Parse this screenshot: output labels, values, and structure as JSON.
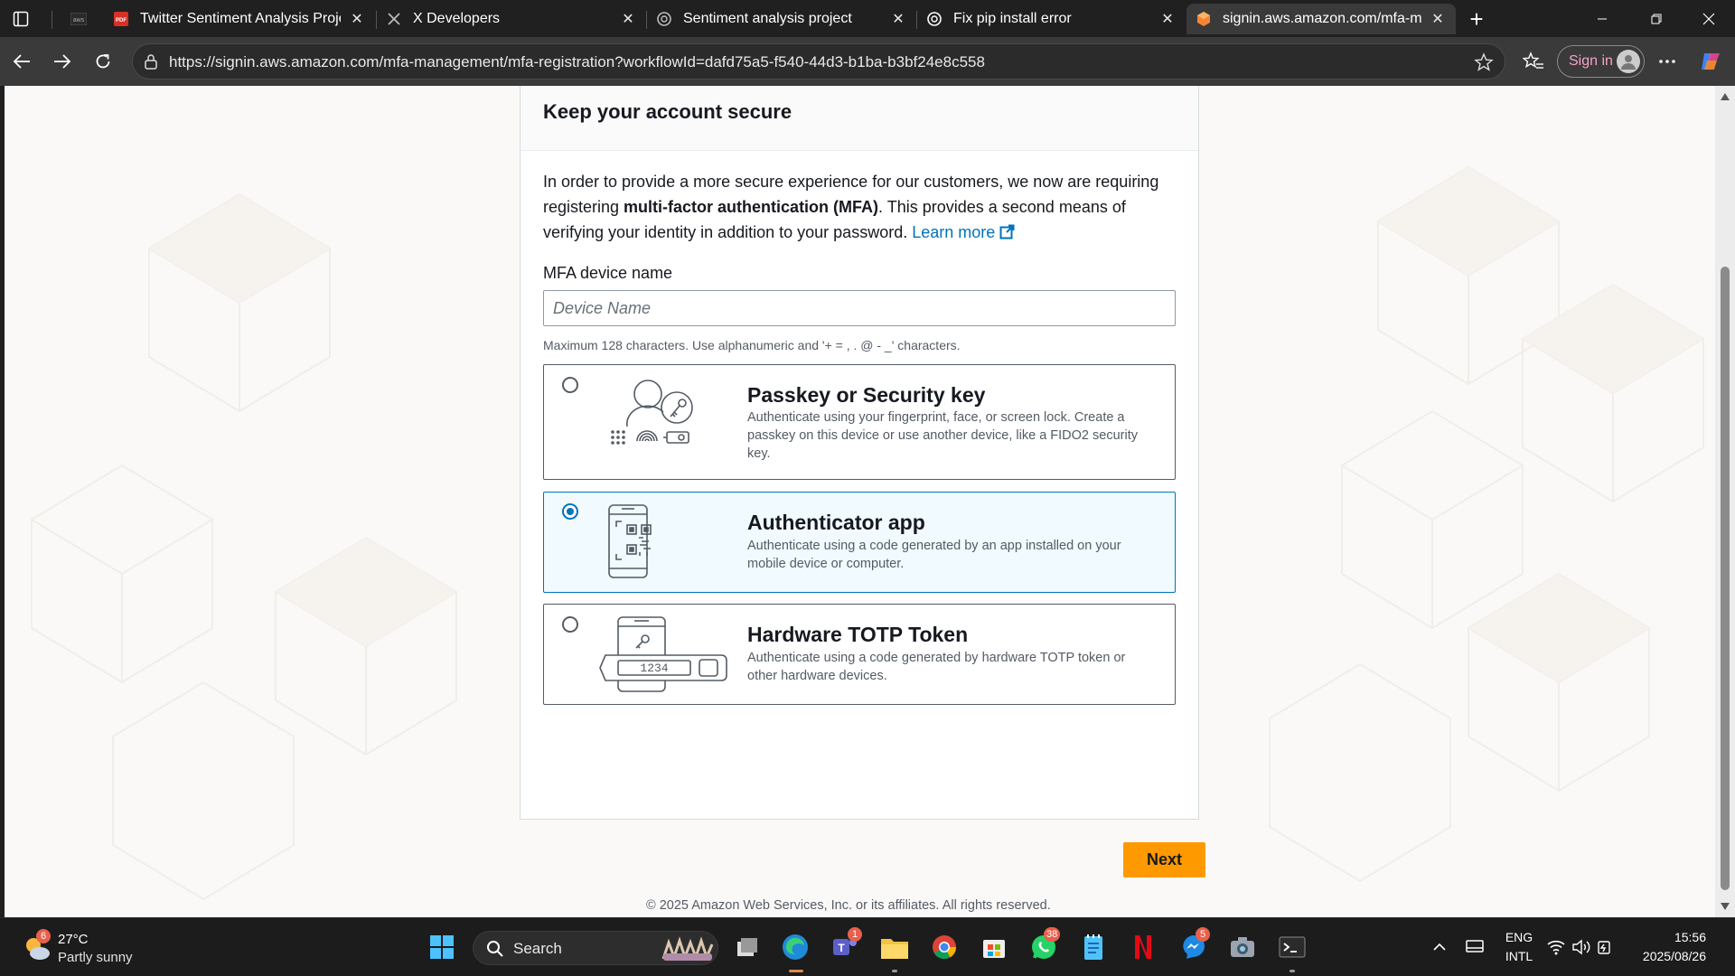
{
  "browser": {
    "tabs": [
      {
        "title": "",
        "favicon": "aws-icon"
      },
      {
        "title": "Twitter Sentiment Analysis Project",
        "favicon": "pdf-icon"
      },
      {
        "title": "X Developers",
        "favicon": "x-logo-icon"
      },
      {
        "title": "Sentiment analysis project",
        "favicon": "chatgpt-icon"
      },
      {
        "title": "Fix pip install error",
        "favicon": "chatgpt-icon"
      },
      {
        "title": "signin.aws.amazon.com/mfa-man",
        "favicon": "aws-cube-icon"
      }
    ],
    "url": "https://signin.aws.amazon.com/mfa-management/mfa-registration?workflowId=dafd75a5-f540-44d3-b1ba-b3bf24e8c558",
    "sign_in_label": "Sign in"
  },
  "page": {
    "title": "Keep your account secure",
    "intro_part1": "In order to provide a more secure experience for our customers, we now are requiring registering ",
    "intro_bold": "multi-factor authentication (MFA)",
    "intro_part2": ". This provides a second means of verifying your identity in addition to your password. ",
    "learn_more": "Learn more",
    "device_label": "MFA device name",
    "device_placeholder": "Device Name",
    "device_hint": "Maximum 128 characters. Use alphanumeric and '+ = , . @ - _' characters.",
    "options": [
      {
        "title": "Passkey or Security key",
        "desc": "Authenticate using your fingerprint, face, or screen lock. Create a passkey on this device or use another device, like a FIDO2 security key.",
        "selected": false
      },
      {
        "title": "Authenticator app",
        "desc": "Authenticate using a code generated by an app installed on your mobile device or computer.",
        "selected": true
      },
      {
        "title": "Hardware TOTP Token",
        "desc": "Authenticate using a code generated by hardware TOTP token or other hardware devices.",
        "selected": false,
        "token_display": "1234"
      }
    ],
    "next_label": "Next",
    "copyright": "© 2025 Amazon Web Services, Inc. or its affiliates. All rights reserved."
  },
  "taskbar": {
    "weather_temp": "27°C",
    "weather_desc": "Partly sunny",
    "weather_badge": "6",
    "search_label": "Search",
    "teams_badge": "1",
    "whatsapp_badge": "38",
    "messenger_badge": "5",
    "lang_line1": "ENG",
    "lang_line2": "INTL",
    "time": "15:56",
    "date": "2025/08/26"
  },
  "colors": {
    "aws_orange": "#ff9900",
    "link_blue": "#0073bb",
    "selected_bg": "#f1faff"
  }
}
